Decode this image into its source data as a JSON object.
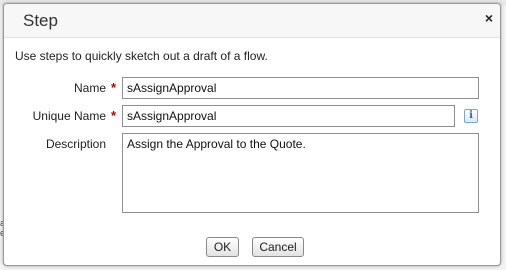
{
  "dialog": {
    "title": "Step",
    "intro": "Use steps to quickly sketch out a draft of a flow."
  },
  "form": {
    "name_label": "Name",
    "name_value": "sAssignApproval",
    "unique_name_label": "Unique Name",
    "unique_name_value": "sAssignApproval",
    "description_label": "Description",
    "description_value": "Assign the Approval to the Quote.",
    "required_marker": "*",
    "info_glyph": "i"
  },
  "buttons": {
    "ok": "OK",
    "cancel": "Cancel",
    "close_glyph": "×"
  },
  "background": {
    "edge_text": "a\ne"
  },
  "colors": {
    "required": "#c00000",
    "info": "#2a6aa8"
  }
}
